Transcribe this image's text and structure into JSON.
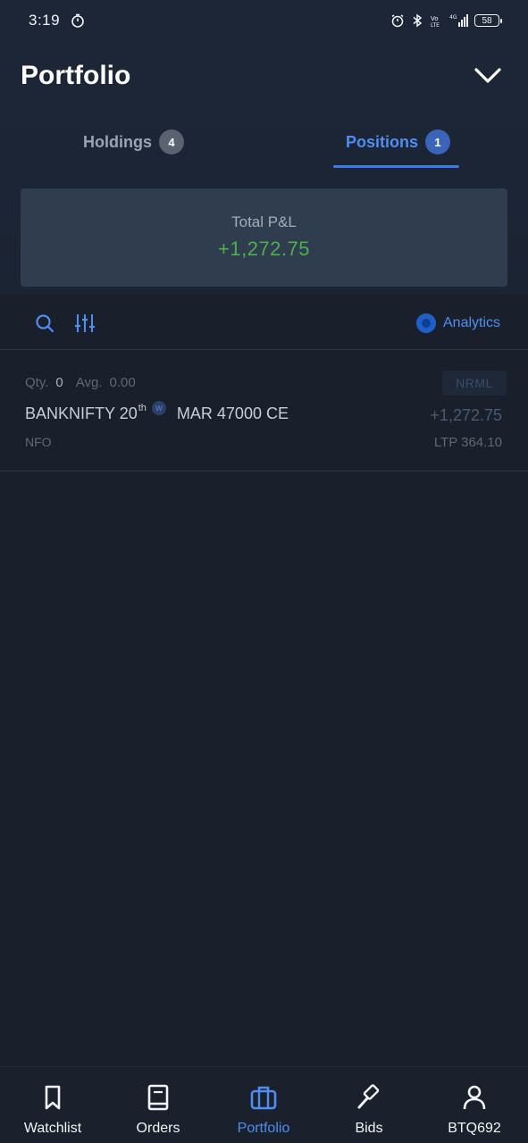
{
  "status_bar": {
    "time": "3:19",
    "battery": "58"
  },
  "header": {
    "title": "Portfolio"
  },
  "tabs": [
    {
      "label": "Holdings",
      "count": "4",
      "active": false
    },
    {
      "label": "Positions",
      "count": "1",
      "active": true
    }
  ],
  "summary": {
    "label": "Total P&L",
    "value": "+1,272.75",
    "value_color": "#4caf50"
  },
  "toolbar": {
    "analytics_label": "Analytics"
  },
  "positions": [
    {
      "qty_label": "Qty.",
      "qty": "0",
      "avg_label": "Avg.",
      "avg": "0.00",
      "product": "NRML",
      "symbol_prefix": "BANKNIFTY 20",
      "symbol_sup": "th",
      "weekly_marker": "W",
      "symbol_suffix": "MAR 47000 CE",
      "pnl": "+1,272.75",
      "exchange": "NFO",
      "ltp": "LTP 364.10"
    }
  ],
  "nav": [
    {
      "label": "Watchlist",
      "icon": "bookmark-icon",
      "active": false
    },
    {
      "label": "Orders",
      "icon": "book-icon",
      "active": false
    },
    {
      "label": "Portfolio",
      "icon": "briefcase-icon",
      "active": true
    },
    {
      "label": "Bids",
      "icon": "gavel-icon",
      "active": false
    },
    {
      "label": "BTQ692",
      "icon": "user-icon",
      "active": false
    }
  ],
  "colors": {
    "accent": "#4f8ef0",
    "profit": "#4caf50",
    "background": "#19202c",
    "card": "#2f3d4f"
  }
}
